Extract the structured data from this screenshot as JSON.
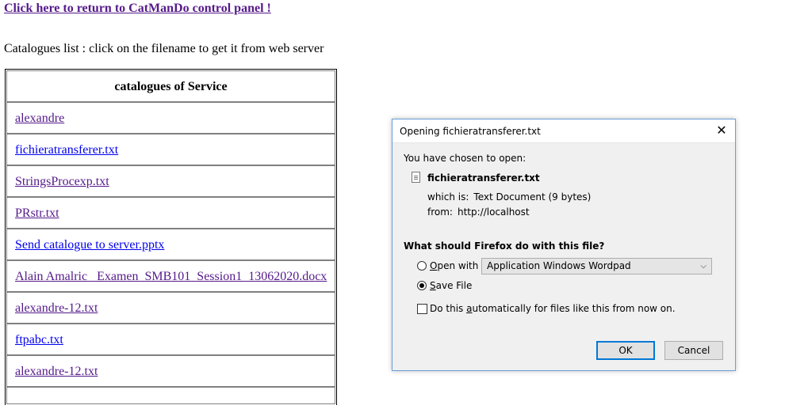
{
  "top_link": "Click here to return to CatManDo control panel !",
  "intro_text": "Catalogues list : click on the filename to get it from web server",
  "table": {
    "header": "catalogues of Service",
    "rows": [
      {
        "name": "alexandre"
      },
      {
        "name": "fichieratransferer.txt"
      },
      {
        "name": "StringsProcexp.txt"
      },
      {
        "name": "PRstr.txt"
      },
      {
        "name": "Send catalogue to server.pptx"
      },
      {
        "name": "Alain Amalric _Examen_SMB101_Session1_13062020.docx"
      },
      {
        "name": "alexandre-12.txt"
      },
      {
        "name": "ftpabc.txt"
      },
      {
        "name": "alexandre-12.txt"
      }
    ]
  },
  "dialog": {
    "title": "Opening fichieratransferer.txt",
    "close_glyph": "✕",
    "chosen_label": "You have chosen to open:",
    "file_name": "fichieratransferer.txt",
    "which_is_label": "which is:",
    "which_is_value": "Text Document (9 bytes)",
    "from_label": "from:",
    "from_value": "http://localhost",
    "question": "What should Firefox do with this file?",
    "open_with_first": "O",
    "open_with_rest": "pen with",
    "open_with_app": "Application Windows Wordpad",
    "save_file_first": "S",
    "save_file_rest": "ave File",
    "auto_pre": "Do this ",
    "auto_u": "a",
    "auto_rest": "utomatically for files like this from now on.",
    "ok_label": "OK",
    "cancel_label": "Cancel",
    "selected_action": "save_file",
    "auto_checked": false
  }
}
